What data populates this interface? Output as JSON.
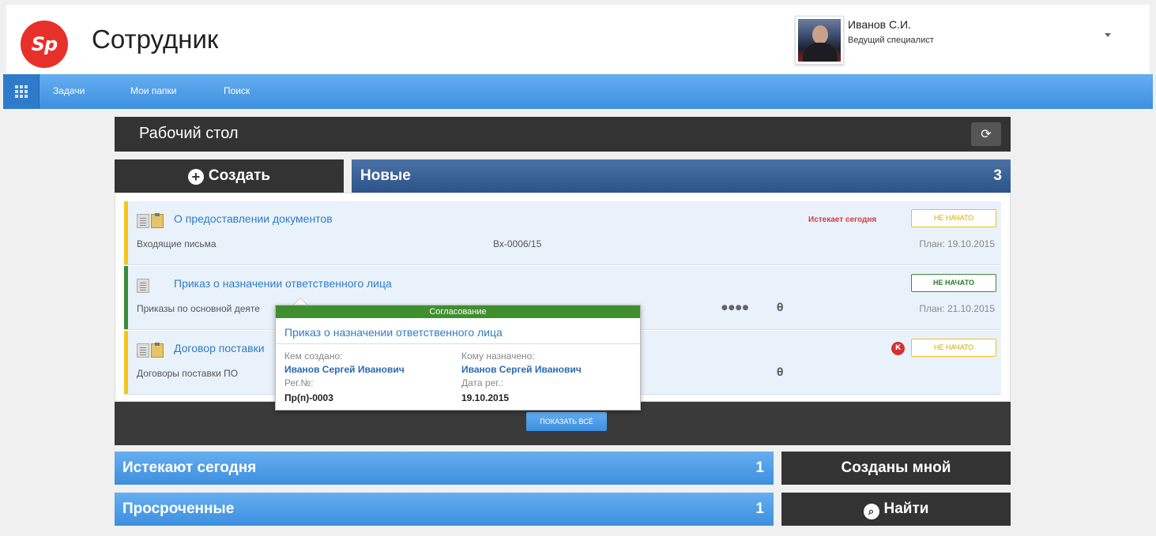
{
  "header": {
    "logo_text": "Sp",
    "title": "Сотрудник",
    "user_name": "Иванов С.И.",
    "user_role": "Ведущий специалист"
  },
  "nav": {
    "items": [
      {
        "label": "Задачи"
      },
      {
        "label": "Мои папки"
      },
      {
        "label": "Поиск"
      }
    ]
  },
  "desktop": {
    "title": "Рабочий стол",
    "refresh_icon": "refresh-icon"
  },
  "create": {
    "label": "Создать"
  },
  "new_section": {
    "label": "Новые",
    "count": "3"
  },
  "tasks": [
    {
      "title": "О предоставлении документов",
      "category": "Входящие письма",
      "reg_no": "Вх-0006/15",
      "plan": "План: 19.10.2015",
      "status": "НЕ НАЧАТО",
      "deadline_note": "Истекает сегодня",
      "stripe_color": "#f5c518"
    },
    {
      "title": "Приказ о назначении ответственного лица",
      "category": "Приказы по основной деяте",
      "plan": "План: 21.10.2015",
      "status": "НЕ НАЧАТО",
      "stripe_color": "#3a8a3a"
    },
    {
      "title": "Договор поставки",
      "category": "Договоры поставки ПО",
      "status": "НЕ НАЧАТО",
      "badge": "К",
      "stripe_color": "#f5c518"
    }
  ],
  "popup": {
    "header": "Согласование",
    "title": "Приказ о назначении ответственного лица",
    "created_by_label": "Кем создано:",
    "created_by": "Иванов Сергей Иванович",
    "assigned_to_label": "Кому назначено:",
    "assigned_to": "Иванов Сергей Иванович",
    "reg_no_label": "Рег.№:",
    "reg_no": "Пр(п)-0003",
    "reg_date_label": "Дата рег.:",
    "reg_date": "19.10.2015"
  },
  "show_all": {
    "label": "ПОКАЗАТЬ ВСЁ"
  },
  "tiles": {
    "expire_today": {
      "label": "Истекают сегодня",
      "count": "1"
    },
    "overdue": {
      "label": "Просроченные",
      "count": "1"
    },
    "created_by_me": {
      "label": "Созданы мной"
    },
    "find": {
      "label": "Найти"
    }
  },
  "colors": {
    "accent_blue": "#3d8fdf",
    "dark": "#333333",
    "new_bar": "#2c5388",
    "popup_green": "#3f8f2f",
    "logo_red": "#e8302a"
  }
}
